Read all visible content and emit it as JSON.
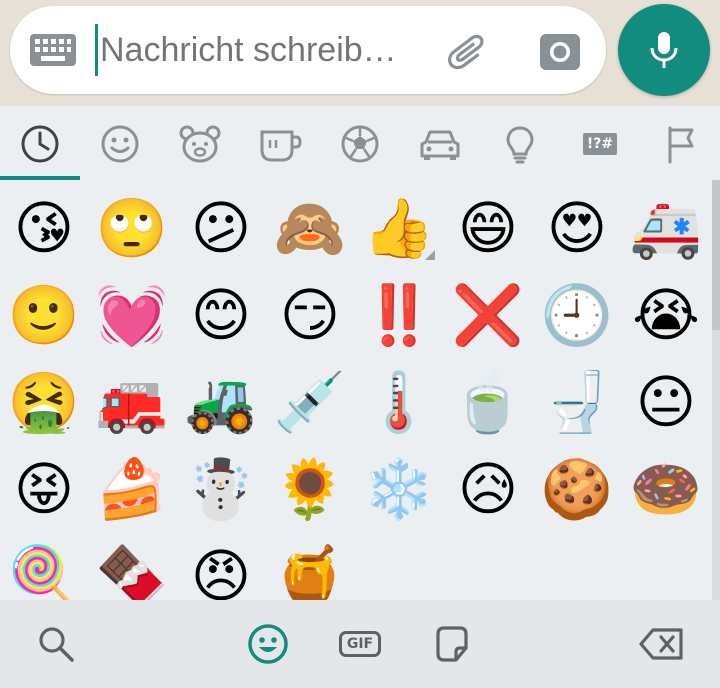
{
  "composer": {
    "placeholder": "Nachricht schreib…"
  },
  "icons": {
    "keyboard": "keyboard-icon",
    "attach": "paperclip-icon",
    "camera": "camera-icon",
    "mic": "microphone-icon",
    "search": "search-icon",
    "emoji": "emoji-icon",
    "gif": "gif-icon",
    "sticker": "sticker-icon",
    "backspace": "backspace-icon"
  },
  "categories": [
    {
      "name": "recent",
      "active": true
    },
    {
      "name": "smileys"
    },
    {
      "name": "animals"
    },
    {
      "name": "food"
    },
    {
      "name": "activities"
    },
    {
      "name": "travel"
    },
    {
      "name": "objects"
    },
    {
      "name": "symbols",
      "label": "!?#"
    },
    {
      "name": "flags"
    }
  ],
  "emojis": [
    "😘",
    "🙄",
    "😕",
    "🙈",
    "👍",
    "😄",
    "😍",
    "🚑",
    "🙂",
    "💓",
    "😊",
    "😏",
    "‼️",
    "❌",
    "🕘",
    "😭",
    "🤮",
    "🚒",
    "🚜",
    "💉",
    "🌡️",
    "🍵",
    "🚽",
    "😐",
    "😝",
    "🍰",
    "☃️",
    "🌻",
    "❄️",
    "😥",
    "🍪",
    "🍩",
    "🍭",
    "🍫",
    "😠",
    "🍯"
  ],
  "bottom": {
    "gif_label": "GIF"
  },
  "colors": {
    "accent": "#128c7e",
    "icon_gray": "#8a9196"
  }
}
